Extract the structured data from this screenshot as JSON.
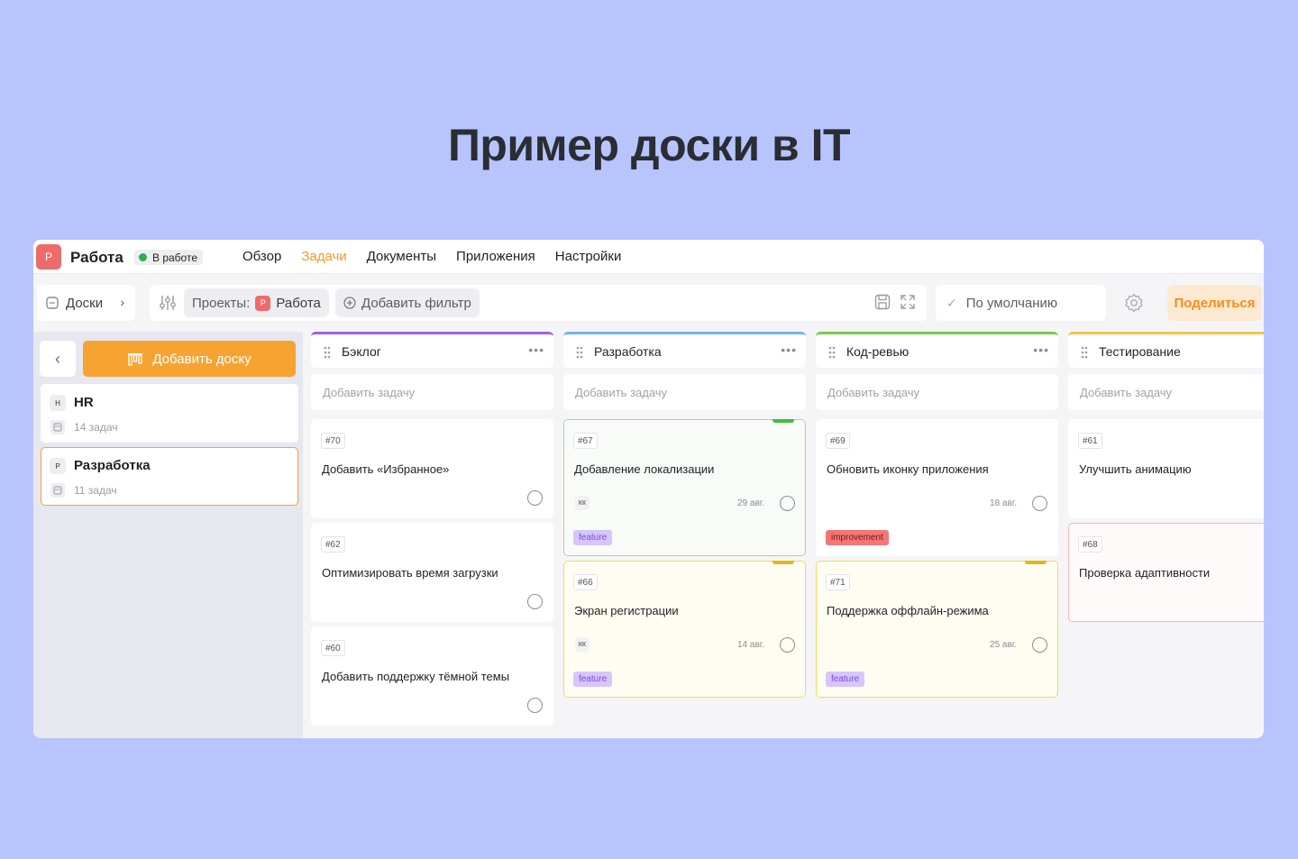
{
  "headline": "Пример доски в IT",
  "topbar": {
    "logo_letter": "Р",
    "project_title": "Работа",
    "status": "В работе",
    "nav": [
      "Обзор",
      "Задачи",
      "Документы",
      "Приложения",
      "Настройки"
    ]
  },
  "toolbar": {
    "boards_label": "Доски",
    "projects_label": "Проекты:",
    "project_logo": "Р",
    "project_value": "Работа",
    "add_filter": "Добавить фильтр",
    "default_view": "По умолчанию",
    "share": "Поделиться"
  },
  "sidebar": {
    "add_board": "Добавить доску",
    "boards": [
      {
        "letter": "H",
        "name": "HR",
        "count": "14 задач"
      },
      {
        "letter": "Р",
        "name": "Разработка",
        "count": "11 задач"
      }
    ]
  },
  "add_task_label": "Добавить задачу",
  "colors": {
    "accent": "#f7a332",
    "backlog": "#a55df0",
    "dev": "#6fb6f5",
    "review": "#7cc84a",
    "testing": "#f7c344"
  },
  "columns": [
    {
      "title": "Бэклог",
      "cards": [
        {
          "id": "#70",
          "title": "Добавить «Избранное»"
        },
        {
          "id": "#62",
          "title": "Оптимизировать время загрузки"
        },
        {
          "id": "#60",
          "title": "Добавить поддержку тёмной темы"
        }
      ]
    },
    {
      "title": "Разработка",
      "cards": [
        {
          "id": "#67",
          "title": "Добавление локализации",
          "assignee": "КК",
          "due": "29 авг.",
          "tag": "feature"
        },
        {
          "id": "#66",
          "title": "Экран регистрации",
          "assignee": "КК",
          "due": "14 авг.",
          "tag": "feature"
        }
      ]
    },
    {
      "title": "Код-ревью",
      "cards": [
        {
          "id": "#69",
          "title": "Обновить иконку приложения",
          "due": "18 авг.",
          "tag": "improvement"
        },
        {
          "id": "#71",
          "title": "Поддержка оффлайн-режима",
          "due": "25 авг.",
          "tag": "feature"
        }
      ]
    },
    {
      "title": "Тестирование",
      "cards": [
        {
          "id": "#61",
          "title": "Улучшить анимацию"
        },
        {
          "id": "#68",
          "title": "Проверка адаптивности"
        }
      ]
    }
  ]
}
